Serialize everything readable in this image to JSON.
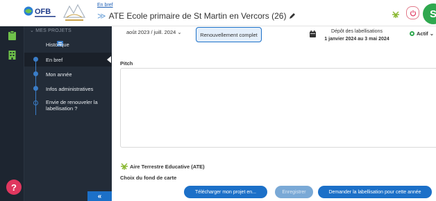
{
  "header": {
    "breadcrumb_link": "En bref",
    "project_title": "ATE Ecole primaire de St Martin en Vercors (26)",
    "avatar_initial": "S",
    "colors": {
      "accent": "#1c70c8",
      "avatar": "#2fa84f",
      "power": "#e27a8a"
    }
  },
  "sidebar": {
    "section_title": "MES PROJETS",
    "items": [
      {
        "label": "Historique"
      },
      {
        "label": "En bref"
      },
      {
        "label": "Mon année"
      },
      {
        "label": "Infos administratives"
      },
      {
        "label": "Envie de renouveler la labellisation ?"
      }
    ],
    "help_label": "?",
    "collapse_label": "«"
  },
  "toolbar": {
    "period": "août 2023 / juill. 2024 ⌄",
    "status": "Renouvellement complet",
    "depot_title": "Dépôt des labellisations",
    "depot_dates": "1 janvier 2024 au 3 mai 2024",
    "actif_label": "Actif ⌄"
  },
  "content": {
    "pitch_label": "Pitch",
    "pitch_value": "",
    "ate_heading": "Aire Terrestre Educative (ATE)",
    "fond_label": "Choix du fond de carte"
  },
  "actions": {
    "download": "Télécharger mon projet en...",
    "save": "Enregistrer",
    "request": "Demander la labellisation pour cette année"
  }
}
